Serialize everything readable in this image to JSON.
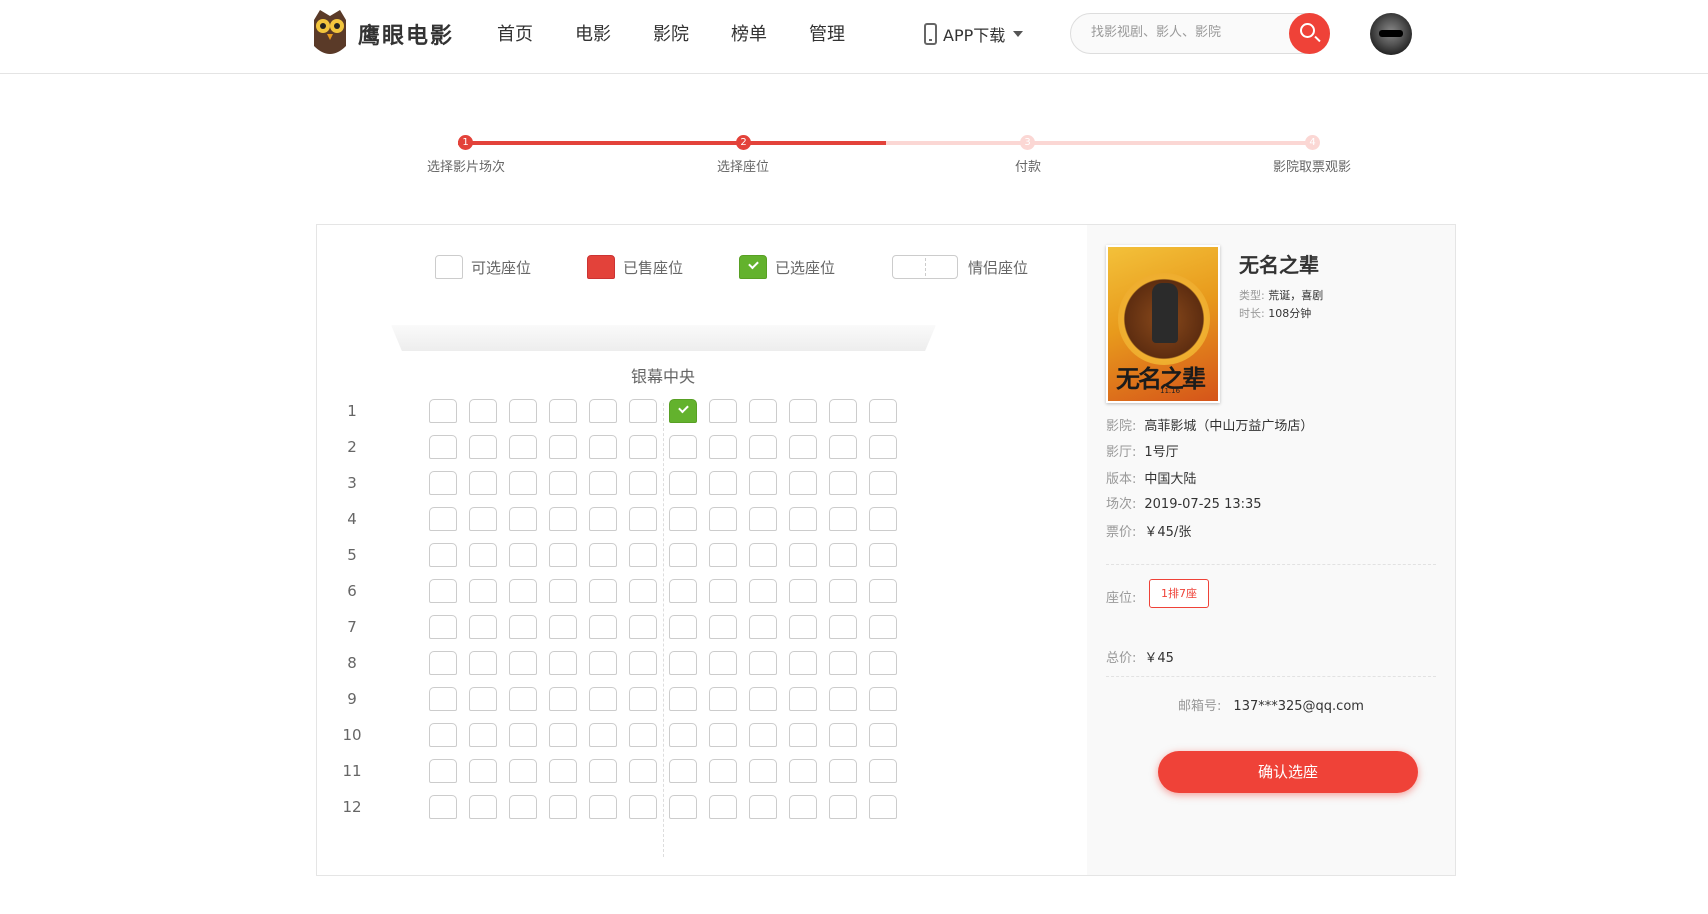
{
  "header": {
    "logo_text": "鹰眼电影",
    "nav": [
      "首页",
      "电影",
      "影院",
      "榜单",
      "管理"
    ],
    "app_download": "APP下载",
    "search_placeholder": "找影视剧、影人、影院"
  },
  "steps": [
    {
      "num": "1",
      "label": "选择影片场次",
      "state": "done"
    },
    {
      "num": "2",
      "label": "选择座位",
      "state": "active"
    },
    {
      "num": "3",
      "label": "付款",
      "state": "todo"
    },
    {
      "num": "4",
      "label": "影院取票观影",
      "state": "todo"
    }
  ],
  "legend": {
    "available": "可选座位",
    "sold": "已售座位",
    "selected": "已选座位",
    "couple": "情侣座位"
  },
  "screen_label": "银幕中央",
  "seatmap": {
    "rows": [
      "1",
      "2",
      "3",
      "4",
      "5",
      "6",
      "7",
      "8",
      "9",
      "10",
      "11",
      "12"
    ],
    "seats_per_row": 12,
    "selected": [
      {
        "row": 1,
        "col": 7
      }
    ]
  },
  "movie": {
    "title": "无名之辈",
    "poster_title": "无名之辈",
    "poster_sub": "11.16",
    "genre_key": "类型:",
    "genre": "荒诞，喜剧",
    "duration_key": "时长:",
    "duration": "108分钟"
  },
  "order": {
    "cinema_key": "影院:",
    "cinema": "高菲影城（中山万益广场店）",
    "hall_key": "影厅:",
    "hall": "1号厅",
    "version_key": "版本:",
    "version": "中国大陆",
    "show_key": "场次:",
    "show": "2019-07-25 13:35",
    "price_key": "票价:",
    "price": "￥45/张",
    "seat_key": "座位:",
    "seat_ticket": "1排7座",
    "total_key": "总价:",
    "total": "￥45",
    "email_key": "邮箱号:",
    "email": "137***325@qq.com",
    "confirm": "确认选座"
  },
  "colors": {
    "accent": "#ef4238",
    "selected": "#63b22d",
    "sold": "#e3423a"
  }
}
